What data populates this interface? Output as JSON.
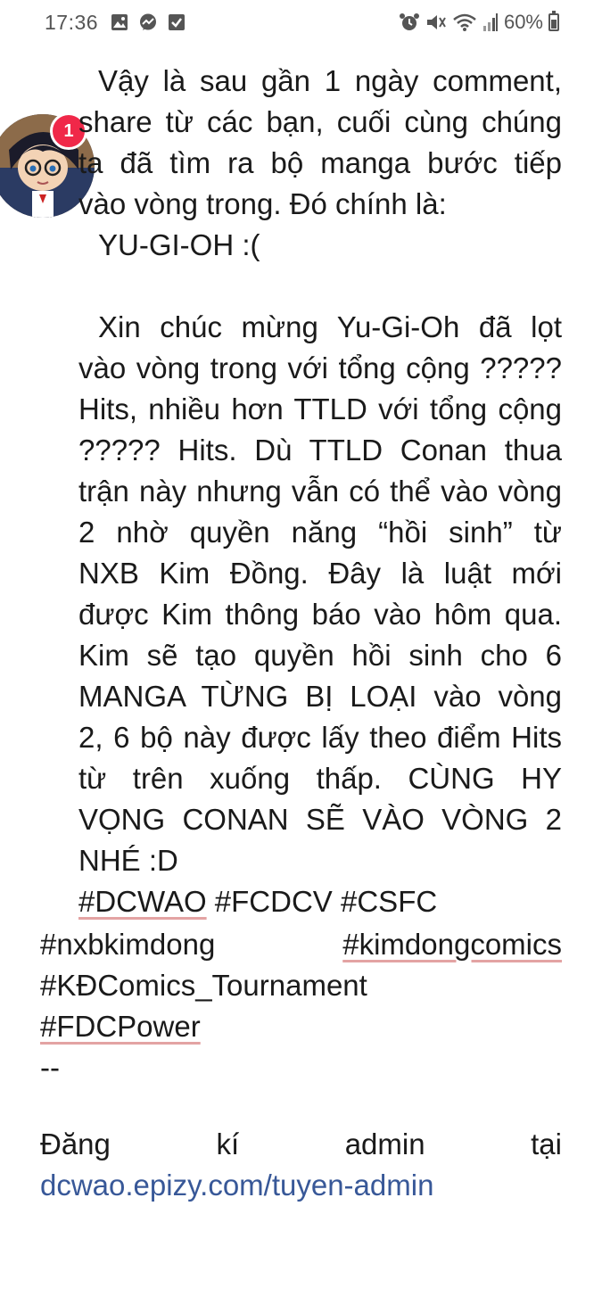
{
  "status_bar": {
    "time": "17:36",
    "battery_percent": "60%",
    "battery_level": 0.6,
    "left_icons": [
      "gallery-icon",
      "messenger-icon",
      "checkbox-icon"
    ],
    "right_icons": [
      "alarm-icon",
      "mute-icon",
      "wifi-icon",
      "signal-icon"
    ]
  },
  "chat_head": {
    "badge_count": "1"
  },
  "post": {
    "p1": [
      "Vậy là sau gần 1 ngày comment,",
      "share từ các bạn, cuối cùng chúng",
      "ta đã tìm ra bộ manga bước tiếp",
      "vào vòng trong. Đó chính là:",
      "YU-GI-OH :("
    ],
    "p2": [
      "Xin chúc mừng Yu-Gi-Oh đã lọt",
      "vào vòng trong với tổng cộng ?????",
      "Hits, nhiều hơn TTLD với tổng cộng",
      "????? Hits. Dù TTLD Conan thua",
      "trận này nhưng vẫn có thể vào vòng",
      "2 nhờ quyền năng “hồi sinh” từ",
      "NXB Kim Đồng. Đây là luật mới",
      "được Kim thông báo vào hôm qua.",
      "Kim sẽ tạo quyền hồi sinh cho 6",
      "MANGA TỪNG BỊ LOẠI vào vòng",
      "2, 6 bộ này được lấy theo điểm Hits",
      "từ trên xuống thấp. CÙNG HY",
      "VỌNG CONAN SẼ VÀO VÒNG 2",
      "NHÉ :D"
    ],
    "hashtags": {
      "dcwao": "#DCWAO",
      "fcdcv": "#FCDCV",
      "csfc": "#CSFC",
      "nxbkimdong": "#nxbkimdong",
      "kimdongcomics": "#kimdongcomics",
      "kdcomics": "#KĐComics_Tournament",
      "fdcpower": "#FDCPower"
    },
    "separator": "--",
    "register_words": [
      "Đăng",
      "kí",
      "admin",
      "tại"
    ],
    "url": "dcwao.epizy.com/tuyen-admin"
  }
}
